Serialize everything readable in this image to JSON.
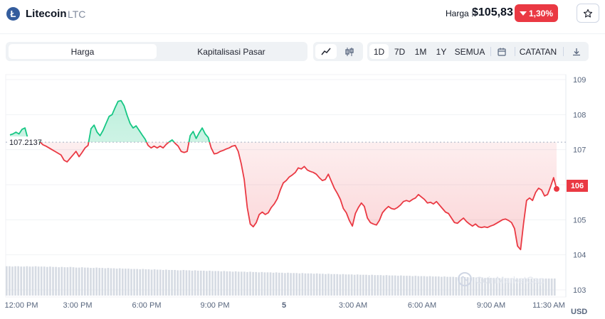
{
  "header": {
    "coin_name": "Litecoin",
    "coin_symbol": "LTC",
    "logo_glyph": "Ł",
    "price_label": "Harga :",
    "price_value": "$105,83",
    "change": "1,30%",
    "change_color": "#ea3943"
  },
  "tabs": [
    {
      "label": "Harga",
      "active": true
    },
    {
      "label": "Kapitalisasi Pasar",
      "active": false
    }
  ],
  "chart_type_toggle": {
    "line_icon": "line-chart-icon",
    "candle_icon": "candlestick-icon",
    "active": "line"
  },
  "ranges": [
    {
      "label": "1D",
      "active": true
    },
    {
      "label": "7D",
      "active": false
    },
    {
      "label": "1M",
      "active": false
    },
    {
      "label": "1Y",
      "active": false
    },
    {
      "label": "SEMUA",
      "active": false
    }
  ],
  "toolbar": {
    "calendar_icon": "calendar-icon",
    "notes_label": "CATATAN",
    "download_icon": "download-icon"
  },
  "chart_data": {
    "type": "area",
    "currency": "USD",
    "reference_price": 107.2137,
    "reference_label": "107.2137",
    "current_label": "106",
    "up_color": "#16c784",
    "down_color": "#ea3943",
    "ylim": [
      103,
      109
    ],
    "yticks": [
      "109",
      "108",
      "107",
      "106",
      "105",
      "104",
      "103"
    ],
    "xticks": [
      "12:00 PM",
      "3:00 PM",
      "6:00 PM",
      "9:00 PM",
      "5",
      "3:00 AM",
      "6:00 AM",
      "9:00 AM",
      "11:30 AM"
    ],
    "watermark": "CoinMarketCap",
    "series": [
      {
        "values": [
          107.42,
          107.45,
          107.5,
          107.45,
          107.58,
          107.62,
          107.3,
          107.18,
          107.12,
          107.2,
          107.22,
          107.14,
          107.1,
          107.05,
          107.0,
          106.95,
          106.9,
          106.85,
          106.7,
          106.65,
          106.75,
          106.85,
          106.95,
          106.8,
          106.92,
          107.05,
          107.12,
          107.6,
          107.7,
          107.5,
          107.4,
          107.55,
          107.75,
          107.95,
          108.0,
          108.2,
          108.38,
          108.4,
          108.25,
          107.98,
          107.75,
          107.62,
          107.68,
          107.55,
          107.42,
          107.3,
          107.12,
          107.05,
          107.1,
          107.05,
          107.1,
          107.05,
          107.15,
          107.22,
          107.28,
          107.18,
          107.1,
          106.95,
          106.92,
          106.95,
          107.4,
          107.52,
          107.32,
          107.48,
          107.62,
          107.45,
          107.35,
          107.05,
          106.88,
          106.9,
          106.95,
          106.98,
          107.02,
          107.05,
          107.1,
          107.12,
          106.95,
          106.6,
          106.15,
          105.35,
          104.88,
          104.8,
          104.92,
          105.15,
          105.22,
          105.15,
          105.2,
          105.35,
          105.45,
          105.6,
          105.85,
          106.05,
          106.12,
          106.22,
          106.28,
          106.35,
          106.48,
          106.45,
          106.52,
          106.42,
          106.38,
          106.35,
          106.3,
          106.2,
          106.12,
          106.15,
          106.3,
          106.1,
          105.9,
          105.75,
          105.58,
          105.32,
          105.2,
          104.98,
          104.82,
          105.18,
          105.35,
          105.48,
          105.38,
          105.05,
          104.92,
          104.88,
          104.85,
          104.98,
          105.2,
          105.3,
          105.38,
          105.32,
          105.3,
          105.35,
          105.42,
          105.52,
          105.55,
          105.52,
          105.58,
          105.62,
          105.72,
          105.65,
          105.58,
          105.48,
          105.5,
          105.45,
          105.52,
          105.42,
          105.32,
          105.22,
          105.18,
          105.05,
          104.92,
          104.9,
          104.98,
          105.05,
          104.95,
          104.88,
          104.82,
          104.88,
          104.8,
          104.78,
          104.8,
          104.78,
          104.82,
          104.85,
          104.9,
          104.95,
          105.0,
          105.02,
          104.98,
          104.92,
          104.75,
          104.25,
          104.15,
          104.9,
          105.55,
          105.62,
          105.55,
          105.78,
          105.9,
          105.85,
          105.68,
          105.72,
          105.95,
          106.2,
          105.88
        ]
      }
    ],
    "volume": [
      0.86,
      0.86,
      0.85,
      0.86,
      0.86,
      0.85,
      0.85,
      0.86,
      0.85,
      0.85,
      0.86,
      0.85,
      0.85,
      0.85,
      0.84,
      0.85,
      0.84,
      0.84,
      0.83,
      0.84,
      0.83,
      0.83,
      0.84,
      0.83,
      0.82,
      0.82,
      0.83,
      0.82,
      0.82,
      0.81,
      0.81,
      0.82,
      0.81,
      0.81,
      0.8,
      0.81,
      0.8,
      0.8,
      0.79,
      0.8,
      0.79,
      0.79,
      0.79,
      0.78,
      0.78,
      0.78,
      0.77,
      0.78,
      0.77,
      0.77,
      0.76,
      0.77,
      0.76,
      0.76,
      0.75,
      0.76,
      0.75,
      0.75,
      0.75,
      0.74,
      0.74,
      0.75,
      0.74,
      0.74,
      0.73,
      0.74,
      0.73,
      0.73,
      0.73,
      0.72,
      0.73,
      0.72,
      0.72,
      0.72,
      0.71,
      0.72,
      0.71,
      0.71,
      0.7,
      0.71,
      0.7,
      0.7,
      0.7,
      0.69,
      0.7,
      0.69,
      0.69,
      0.68,
      0.69,
      0.68,
      0.68,
      0.68,
      0.67,
      0.68,
      0.67,
      0.67,
      0.66,
      0.67,
      0.66,
      0.66,
      0.66,
      0.65,
      0.66,
      0.65,
      0.65,
      0.65,
      0.64,
      0.65,
      0.64,
      0.64,
      0.63,
      0.64,
      0.63,
      0.63,
      0.63,
      0.62,
      0.63,
      0.62,
      0.62,
      0.62,
      0.61,
      0.62,
      0.61,
      0.61,
      0.61,
      0.6,
      0.61,
      0.6,
      0.6,
      0.6,
      0.59,
      0.6,
      0.59,
      0.59,
      0.59,
      0.58,
      0.59,
      0.58,
      0.58,
      0.58,
      0.57,
      0.58,
      0.57,
      0.57,
      0.57,
      0.56,
      0.57,
      0.56,
      0.56,
      0.56,
      0.55,
      0.56,
      0.55,
      0.55,
      0.55,
      0.54,
      0.55,
      0.54,
      0.54,
      0.54,
      0.53,
      0.54,
      0.53,
      0.53,
      0.53,
      0.52,
      0.53,
      0.52,
      0.52,
      0.52,
      0.51,
      0.52,
      0.51,
      0.51,
      0.51,
      0.5,
      0.51,
      0.5,
      0.5,
      0.5,
      0.5,
      0.5,
      0.5,
      0.5,
      0.5,
      0.5,
      0.5,
      0.5,
      0.5,
      0.5
    ]
  }
}
